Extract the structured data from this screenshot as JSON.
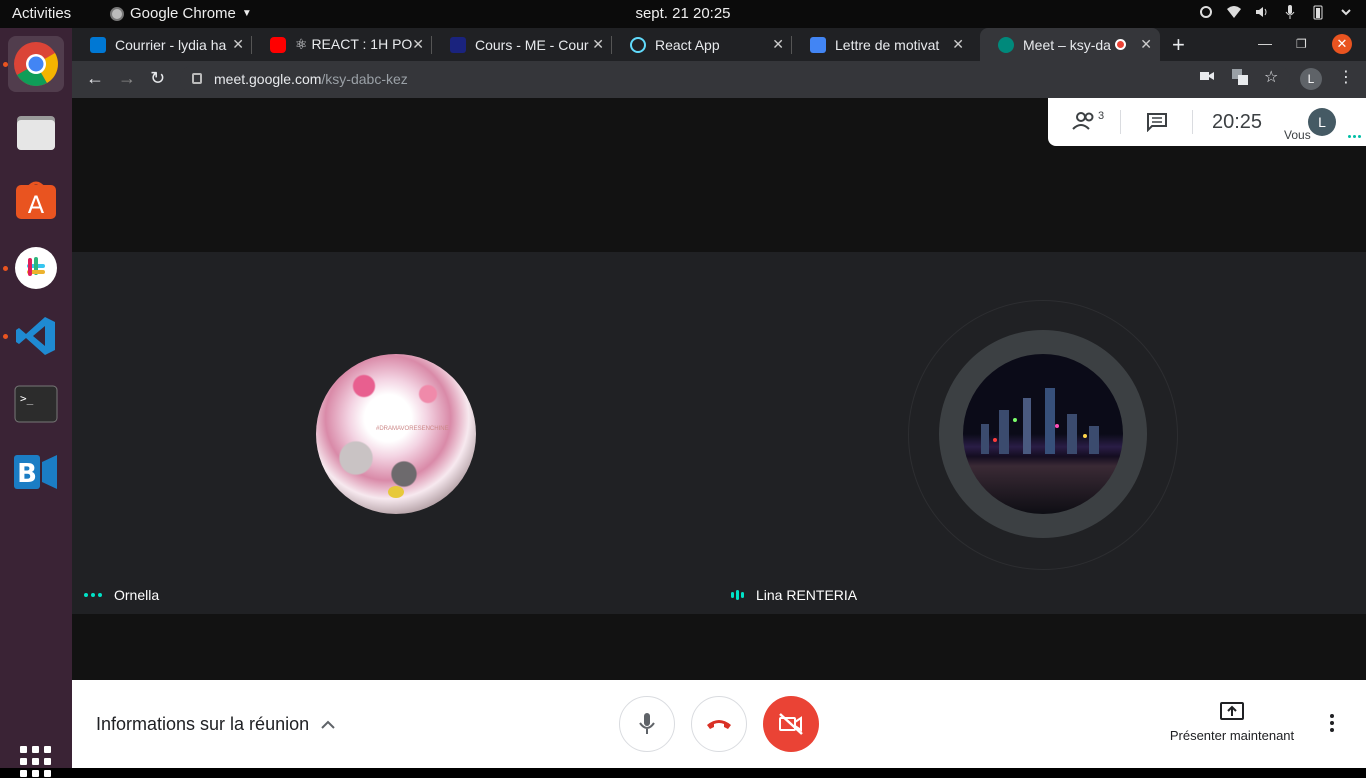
{
  "system": {
    "activities": "Activities",
    "app_name": "Google Chrome",
    "datetime": "sept. 21  20:25"
  },
  "tabs": [
    {
      "title": "Courrier - lydia ha",
      "color": "#0078d4"
    },
    {
      "title": "⚛ REACT : 1H PO",
      "color": "#ff0000"
    },
    {
      "title": "Cours - ME - Cour",
      "color": "#1a237e"
    },
    {
      "title": "React App",
      "color": "#61dafb"
    },
    {
      "title": "Lettre de motivat",
      "color": "#4285f4"
    },
    {
      "title": "Meet – ksy-da",
      "color": "#00897b"
    }
  ],
  "address": {
    "host": "meet.google.com",
    "path": "/ksy-dabc-kez",
    "profile_initial": "L"
  },
  "meet": {
    "participant_count": "3",
    "time": "20:25",
    "you_label": "Vous",
    "you_initial": "L",
    "participants": [
      {
        "name": "Ornella"
      },
      {
        "name": "Lina RENTERIA"
      }
    ],
    "watermark": "#DRAMAVORESENCHINE"
  },
  "bottom": {
    "info_label": "Informations sur la réunion",
    "present_label": "Présenter maintenant"
  },
  "colors": {
    "accent_red": "#ea4335",
    "speaking": "#00e2c6"
  }
}
